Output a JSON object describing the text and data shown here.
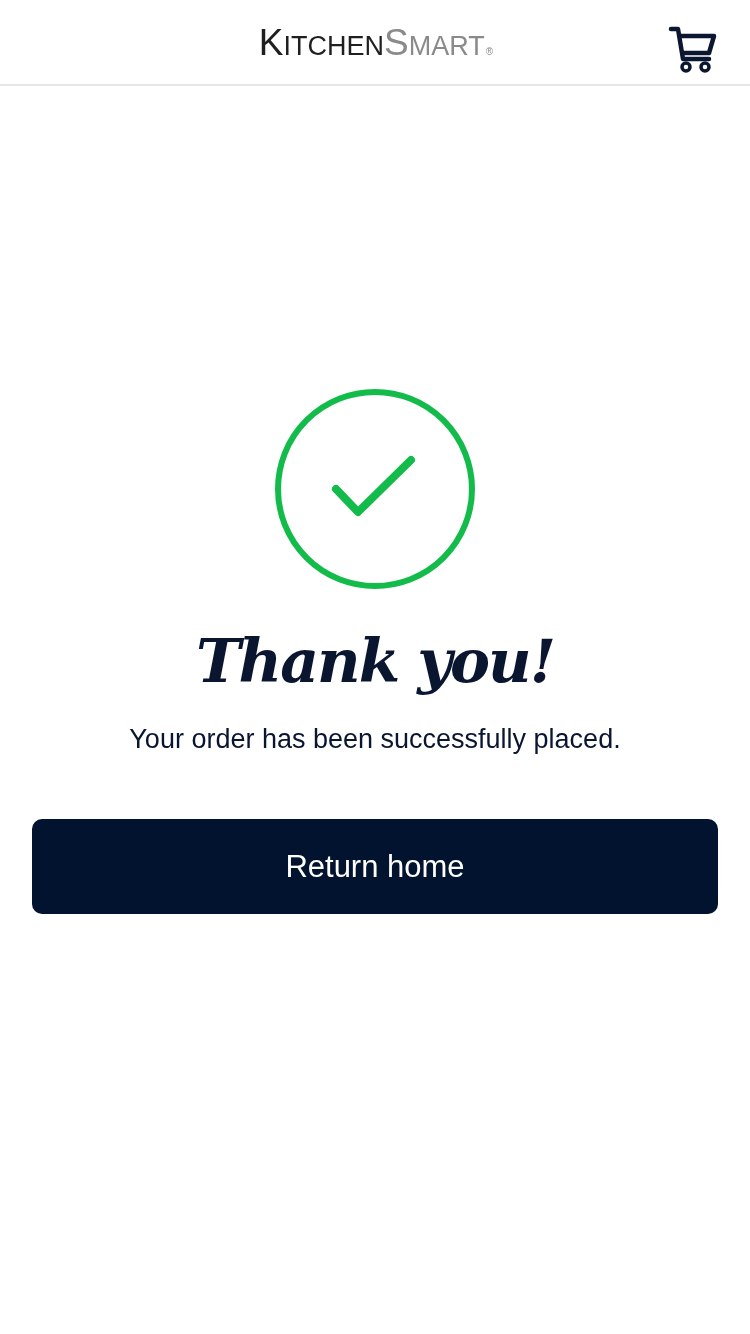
{
  "header": {
    "logo": {
      "first_word": "KITCHEN",
      "second_word": "SMART",
      "mark": "®"
    }
  },
  "confirmation": {
    "kind": "success",
    "title": "Thank you!",
    "message": "Your order has been successfully placed."
  },
  "buttons": [
    {
      "label": "Return home"
    }
  ]
}
